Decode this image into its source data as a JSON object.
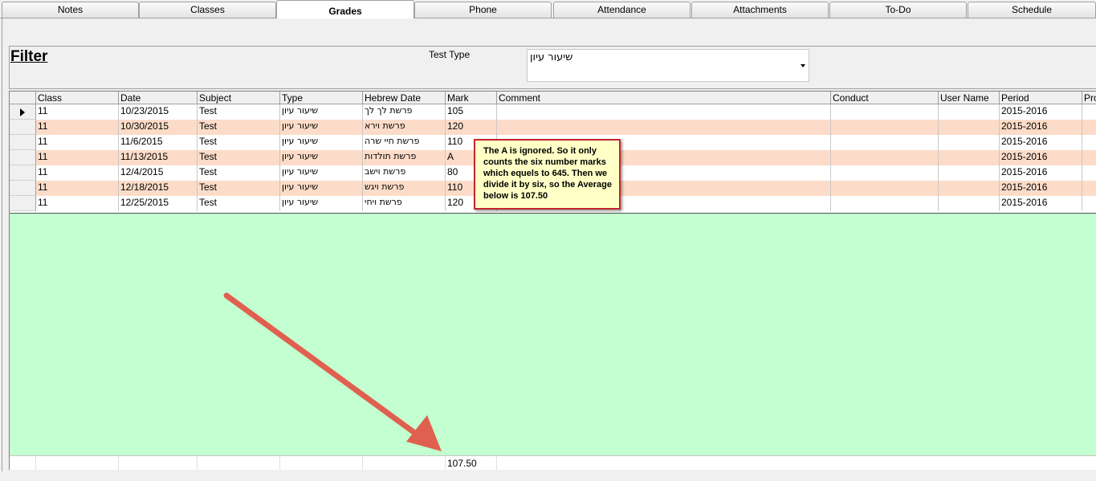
{
  "tabs": [
    {
      "label": "Notes"
    },
    {
      "label": "Classes"
    },
    {
      "label": "Grades"
    },
    {
      "label": "Phone"
    },
    {
      "label": "Attendance"
    },
    {
      "label": "Attachments"
    },
    {
      "label": "To-Do"
    },
    {
      "label": "Schedule"
    }
  ],
  "active_tab": "Grades",
  "filter": {
    "title": "Filter",
    "test_type_label": "Test Type",
    "test_type_value": "שיעור עיון"
  },
  "grid": {
    "columns": [
      "Class",
      "Date",
      "Subject",
      "Type",
      "Hebrew Date",
      "Mark",
      "Comment",
      "Conduct",
      "User Name",
      "Period",
      "Pro"
    ],
    "rows": [
      [
        "11",
        "10/23/2015",
        "Test",
        "שיעור עיון",
        "פרשת לך לך",
        "105",
        "",
        "",
        "",
        "2015-2016",
        ""
      ],
      [
        "11",
        "10/30/2015",
        "Test",
        "שיעור עיון",
        "פרשת וירא",
        "120",
        "",
        "",
        "",
        "2015-2016",
        ""
      ],
      [
        "11",
        "11/6/2015",
        "Test",
        "שיעור עיון",
        "פרשת חיי שרה",
        "110",
        "",
        "",
        "",
        "2015-2016",
        ""
      ],
      [
        "11",
        "11/13/2015",
        "Test",
        "שיעור עיון",
        "פרשת תולדות",
        "A",
        "",
        "",
        "",
        "2015-2016",
        ""
      ],
      [
        "11",
        "12/4/2015",
        "Test",
        "שיעור עיון",
        "פרשת וישב",
        "80",
        "",
        "",
        "",
        "2015-2016",
        ""
      ],
      [
        "11",
        "12/18/2015",
        "Test",
        "שיעור עיון",
        "פרשת ויגש",
        "110",
        "",
        "",
        "",
        "2015-2016",
        ""
      ],
      [
        "11",
        "12/25/2015",
        "Test",
        "שיעור עיון",
        "פרשת ויחי",
        "120",
        "",
        "",
        "",
        "2015-2016",
        ""
      ]
    ],
    "footer_average": "107.50"
  },
  "callout": {
    "text": "The A is ignored. So it only counts the six number marks which equels to 645. Then we divide it by six, so the Average below is 107.50"
  },
  "colors": {
    "row_alt": "#fcdcc8",
    "grid_background": "#c3ffd0",
    "callout_background": "#ffffc6",
    "callout_border": "#c0282d",
    "arrow": "#e06050"
  }
}
